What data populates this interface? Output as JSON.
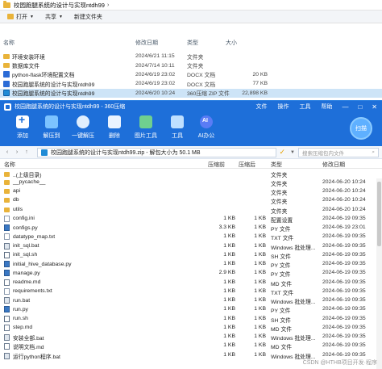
{
  "explorer": {
    "title": "校园跑腿系统的设计与实现ntdh99",
    "toolbar": {
      "open_label": "打开",
      "share_label": "共享",
      "new_folder_label": "新建文件夹"
    },
    "columns": {
      "name": "名称",
      "date": "修改日期",
      "type": "类型",
      "size": "大小"
    },
    "rows": [
      {
        "name": "环境安装环境",
        "date": "2024/6/21 11:15",
        "type": "文件夹",
        "size": "",
        "icon": "folder-icon"
      },
      {
        "name": "数据库文件",
        "date": "2024/7/14 10:11",
        "type": "文件夹",
        "size": "",
        "icon": "folder-icon"
      },
      {
        "name": "python-flask环境配置文档",
        "date": "2024/6/19 23:02",
        "type": "DOCX 文档",
        "size": "20 KB",
        "icon": "docx-icon"
      },
      {
        "name": "校园跑腿系统的设计与实现ntdh99",
        "date": "2024/6/19 23:02",
        "type": "DOCX 文档",
        "size": "77 KB",
        "icon": "docx-icon"
      },
      {
        "name": "校园跑腿系统的设计与实现ntdh99",
        "date": "2024/6/20 10:24",
        "type": "360压缩 ZIP 文件",
        "size": "22,898 KB",
        "icon": "zip-icon"
      }
    ]
  },
  "zip": {
    "title": "校园跑腿系统的设计与实现ntdh99 - 360压缩",
    "menu": [
      "文件",
      "操作",
      "工具",
      "帮助"
    ],
    "ribbon": [
      {
        "label": "添加",
        "icon": "add-icon"
      },
      {
        "label": "解压到",
        "icon": "extract-icon"
      },
      {
        "label": "一键解压",
        "icon": "one-click-extract-icon"
      },
      {
        "label": "删除",
        "icon": "delete-icon"
      },
      {
        "label": "图片工具",
        "icon": "image-tool-icon"
      },
      {
        "label": "工具",
        "icon": "tools-icon"
      },
      {
        "label": "AI办公",
        "icon": "ai-office-icon"
      }
    ],
    "scan_label": "扫描",
    "address": "校园跑腿系统的设计与实现ntdh99.zip - 解包大小为 50.1 MB",
    "search_placeholder": "搜索压缩包内文件",
    "columns": {
      "name": "名称",
      "compressed": "压缩前",
      "original": "压缩后",
      "type": "类型",
      "date": "修改日期"
    },
    "rows": [
      {
        "name": "..(上级目录)",
        "c": "",
        "o": "",
        "type": "文件夹",
        "date": "",
        "icon": "folder-icon"
      },
      {
        "name": "__pycache__",
        "c": "",
        "o": "",
        "type": "文件夹",
        "date": "2024-06-20 10:24",
        "icon": "folder-icon"
      },
      {
        "name": "api",
        "c": "",
        "o": "",
        "type": "文件夹",
        "date": "2024-06-20 10:24",
        "icon": "folder-icon"
      },
      {
        "name": "db",
        "c": "",
        "o": "",
        "type": "文件夹",
        "date": "2024-06-20 10:24",
        "icon": "folder-icon"
      },
      {
        "name": "utils",
        "c": "",
        "o": "",
        "type": "文件夹",
        "date": "2024-06-20 10:24",
        "icon": "folder-icon"
      },
      {
        "name": "config.ini",
        "c": "1 KB",
        "o": "1 KB",
        "type": "配置设置",
        "date": "2024-06-19 09:35",
        "icon": "file-icon"
      },
      {
        "name": "configs.py",
        "c": "3.3 KB",
        "o": "1 KB",
        "type": "PY 文件",
        "date": "2024-06-19 23:01",
        "icon": "python-icon"
      },
      {
        "name": "datatype_map.txt",
        "c": "1 KB",
        "o": "1 KB",
        "type": "TXT 文件",
        "date": "2024-06-19 09:35",
        "icon": "file-icon"
      },
      {
        "name": "init_sql.bat",
        "c": "1 KB",
        "o": "1 KB",
        "type": "Windows 批处理...",
        "date": "2024-06-19 09:35",
        "icon": "batch-icon"
      },
      {
        "name": "init_sql.sh",
        "c": "1 KB",
        "o": "1 KB",
        "type": "SH 文件",
        "date": "2024-06-19 09:35",
        "icon": "shell-icon"
      },
      {
        "name": "initial_hive_database.py",
        "c": "1 KB",
        "o": "1 KB",
        "type": "PY 文件",
        "date": "2024-06-19 09:35",
        "icon": "python-icon"
      },
      {
        "name": "manage.py",
        "c": "2.9 KB",
        "o": "1 KB",
        "type": "PY 文件",
        "date": "2024-06-19 09:35",
        "icon": "python-icon"
      },
      {
        "name": "readme.md",
        "c": "1 KB",
        "o": "1 KB",
        "type": "MD 文件",
        "date": "2024-06-19 09:35",
        "icon": "markdown-icon"
      },
      {
        "name": "requirements.txt",
        "c": "1 KB",
        "o": "1 KB",
        "type": "TXT 文件",
        "date": "2024-06-19 09:35",
        "icon": "file-icon"
      },
      {
        "name": "run.bat",
        "c": "1 KB",
        "o": "1 KB",
        "type": "Windows 批处理...",
        "date": "2024-06-19 09:35",
        "icon": "batch-icon"
      },
      {
        "name": "run.py",
        "c": "1 KB",
        "o": "1 KB",
        "type": "PY 文件",
        "date": "2024-06-19 09:35",
        "icon": "python-icon"
      },
      {
        "name": "run.sh",
        "c": "1 KB",
        "o": "1 KB",
        "type": "SH 文件",
        "date": "2024-06-19 09:35",
        "icon": "shell-icon"
      },
      {
        "name": "step.md",
        "c": "1 KB",
        "o": "1 KB",
        "type": "MD 文件",
        "date": "2024-06-19 09:35",
        "icon": "markdown-icon"
      },
      {
        "name": "安装全部.bat",
        "c": "1 KB",
        "o": "1 KB",
        "type": "Windows 批处理...",
        "date": "2024-06-19 09:35",
        "icon": "batch-icon"
      },
      {
        "name": "说明文档.md",
        "c": "1 KB",
        "o": "1 KB",
        "type": "MD 文件",
        "date": "2024-06-19 09:35",
        "icon": "markdown-icon"
      },
      {
        "name": "运行python程序.bat",
        "c": "1 KB",
        "o": "1 KB",
        "type": "Windows 批处理...",
        "date": "2024-06-19 09:35",
        "icon": "batch-icon"
      }
    ]
  },
  "watermark": "CSDN @HTHB项目开发·程序"
}
